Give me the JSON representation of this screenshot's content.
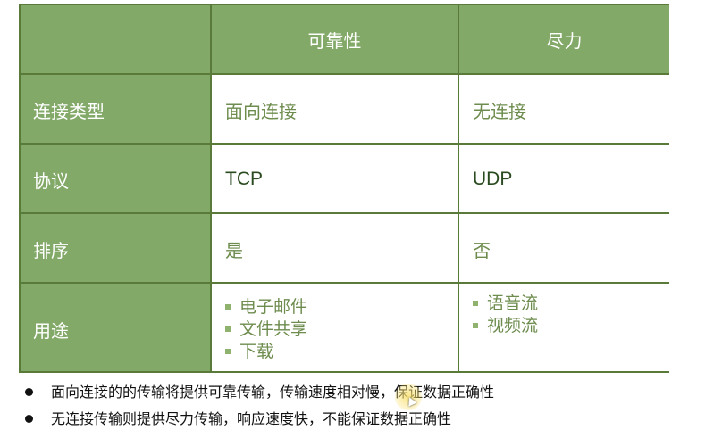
{
  "table": {
    "header": {
      "corner": "",
      "col1": "可靠性",
      "col2": "尽力"
    },
    "rows": [
      {
        "label": "连接类型",
        "col1": "面向连接",
        "col2": "无连接"
      },
      {
        "label": "协议",
        "col1": "TCP",
        "col2": "UDP"
      },
      {
        "label": "排序",
        "col1": "是",
        "col2": "否"
      },
      {
        "label": "用途",
        "col1_items": [
          "电子邮件",
          "文件共享",
          "下载"
        ],
        "col2_items": [
          "语音流",
          "视频流"
        ]
      }
    ]
  },
  "notes": [
    "面向连接的的传输将提供可靠传输，传输速度相对慢，保证数据正确性",
    "无连接传输则提供尽力传输，响应速度快，不能保证数据正确性"
  ],
  "colors": {
    "header_green": "#82a968",
    "border_green": "#5a7a3a",
    "text_green": "#6d8c4e"
  }
}
